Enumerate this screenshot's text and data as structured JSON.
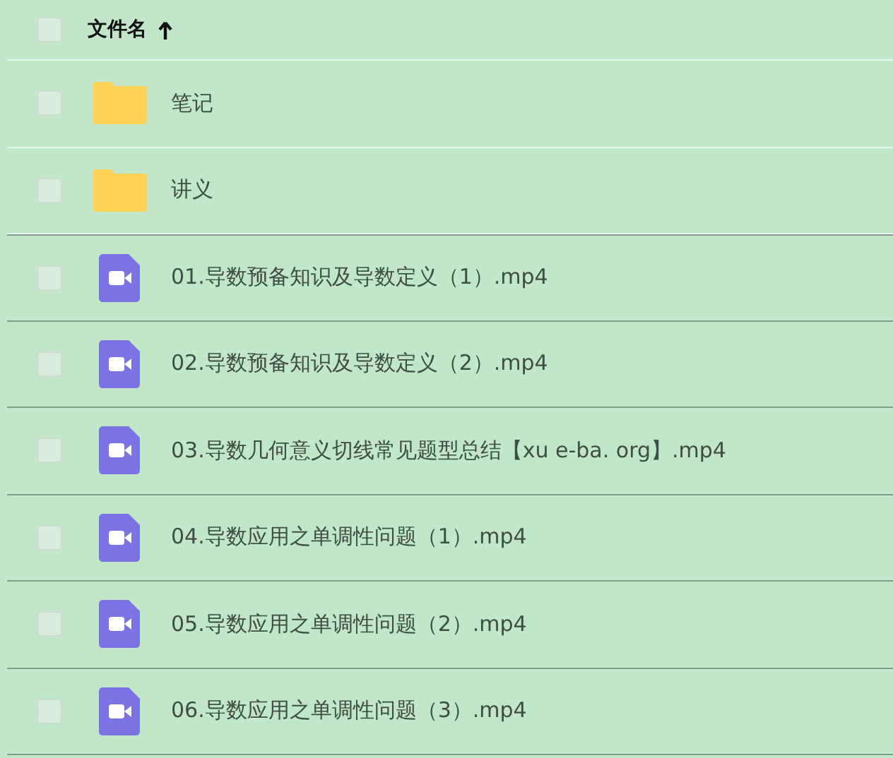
{
  "header": {
    "label": "文件名",
    "checked": false
  },
  "files": [
    {
      "kind": "folder",
      "name": "笔记",
      "checked": false
    },
    {
      "kind": "folder",
      "name": "讲义",
      "checked": false
    },
    {
      "kind": "video",
      "name": "01.导数预备知识及导数定义（1）.mp4",
      "checked": false
    },
    {
      "kind": "video",
      "name": "02.导数预备知识及导数定义（2）.mp4",
      "checked": false
    },
    {
      "kind": "video",
      "name": "03.导数几何意义切线常见题型总结【xu e-ba. org】.mp4",
      "checked": false
    },
    {
      "kind": "video",
      "name": "04.导数应用之单调性问题（1）.mp4",
      "checked": false
    },
    {
      "kind": "video",
      "name": "05.导数应用之单调性问题（2）.mp4",
      "checked": false
    },
    {
      "kind": "video",
      "name": "06.导数应用之单调性问题（3）.mp4",
      "checked": false
    }
  ]
}
